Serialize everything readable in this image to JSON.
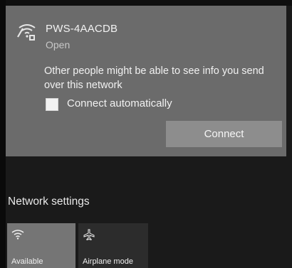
{
  "network": {
    "ssid": "PWS-4AACDB",
    "status": "Open",
    "warning": "Other people might be able to see info you send over this network",
    "connect_automatically_label": "Connect automatically",
    "connect_automatically_checked": false,
    "connect_label": "Connect"
  },
  "network_settings_label": "Network settings",
  "quick_actions": [
    {
      "label": "Available",
      "icon": "wifi-icon",
      "active": true
    },
    {
      "label": "Airplane mode",
      "icon": "airplane-icon",
      "active": false
    }
  ],
  "colors": {
    "panel": "#6b6b6b",
    "background": "#1a1a1a",
    "button": "#8d8d8d",
    "tile_active": "#757575",
    "tile_inactive": "#2c2c2c",
    "text": "#f1f1f1"
  }
}
